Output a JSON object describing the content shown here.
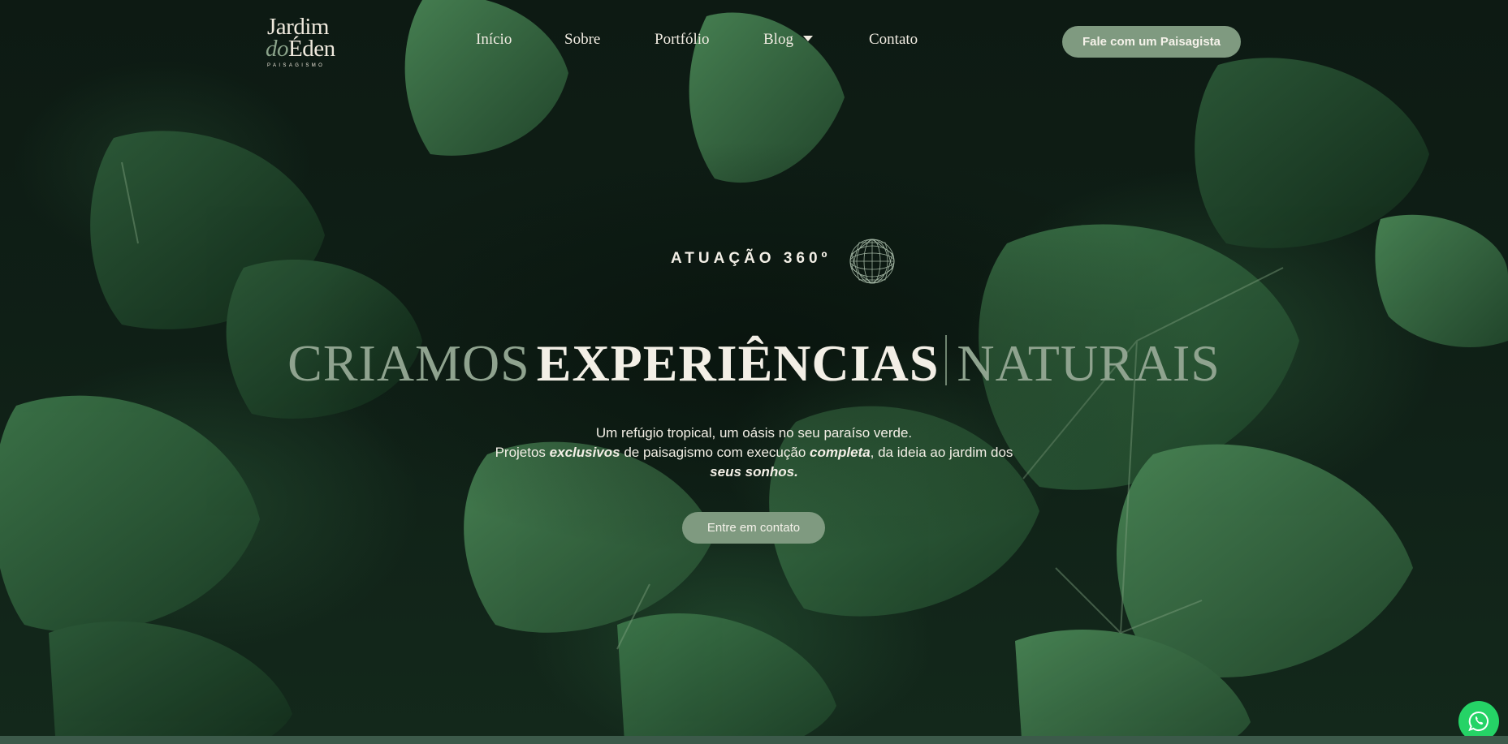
{
  "brand": {
    "line1": "Jardim",
    "line2_italic": "do",
    "line2_rest": "Éden",
    "tagline": "PAISAGISMO"
  },
  "nav": {
    "items": [
      {
        "label": "Início"
      },
      {
        "label": "Sobre"
      },
      {
        "label": "Portfólio"
      },
      {
        "label": "Blog"
      },
      {
        "label": "Contato"
      }
    ]
  },
  "header": {
    "cta_label": "Fale com um Paisagista"
  },
  "hero": {
    "eyebrow": "ATUAÇÃO 360º",
    "headline_part1": "CRIAMOS",
    "headline_part2": "EXPERIÊNCIAS",
    "headline_part3": "NATURAIS",
    "sub_line1": "Um refúgio tropical, um oásis no seu paraíso verde.",
    "sub_line2_a": "Projetos ",
    "sub_line2_b": "exclusivos",
    "sub_line2_c": " de paisagismo com execução ",
    "sub_line2_d": "completa",
    "sub_line2_e": ", da ideia ao jardim dos",
    "sub_line3_a": "seus sonhos",
    "sub_line3_b": ".",
    "cta_label": "Entre em contato"
  },
  "floating": {
    "whatsapp_icon": "whatsapp-icon"
  },
  "colors": {
    "accent": "#7f9a80",
    "text_light": "#f3efe6",
    "text_muted": "#8fa38f",
    "background": "#0d1a13",
    "whatsapp": "#25d366"
  }
}
